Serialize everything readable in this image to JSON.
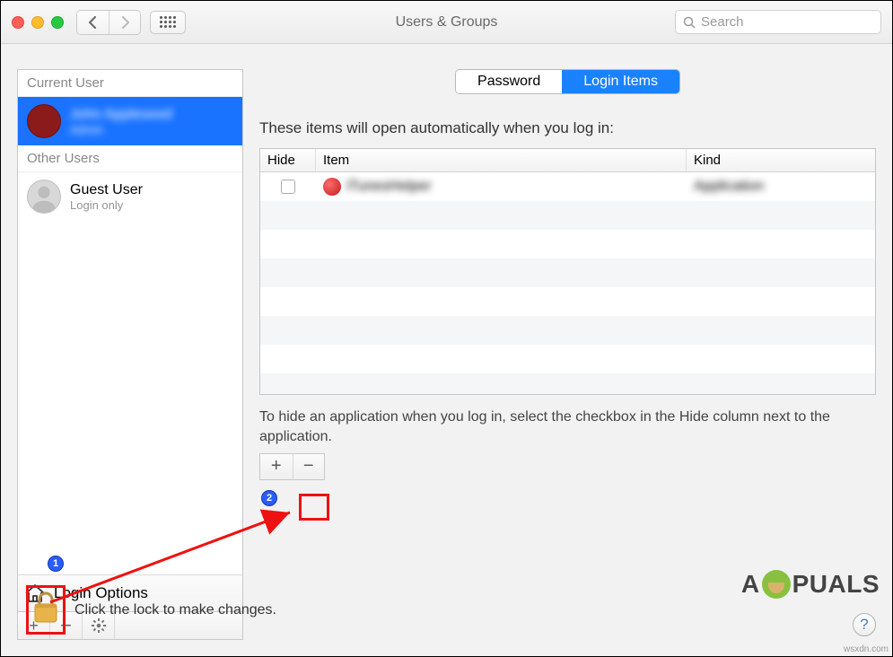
{
  "window": {
    "title": "Users & Groups",
    "search_placeholder": "Search"
  },
  "sidebar": {
    "current_label": "Current User",
    "other_label": "Other Users",
    "current_user": {
      "name": "John Appleseed",
      "role": "Admin"
    },
    "guest_user": {
      "name": "Guest User",
      "role": "Login only"
    },
    "login_options": "Login Options"
  },
  "tabs": {
    "password": "Password",
    "login_items": "Login Items",
    "active": "login_items"
  },
  "login_items": {
    "header_text": "These items will open automatically when you log in:",
    "columns": {
      "hide": "Hide",
      "item": "Item",
      "kind": "Kind"
    },
    "rows": [
      {
        "hide": false,
        "item": "iTunesHelper",
        "kind": "Application"
      }
    ],
    "hint": "To hide an application when you log in, select the checkbox in the Hide column next to the application."
  },
  "lock_text": "Click the lock to make changes.",
  "annotations": {
    "one": "1",
    "two": "2"
  },
  "watermark": {
    "pre": "A",
    "post": "PUALS"
  },
  "attribution": "wsxdn.com",
  "help": "?"
}
